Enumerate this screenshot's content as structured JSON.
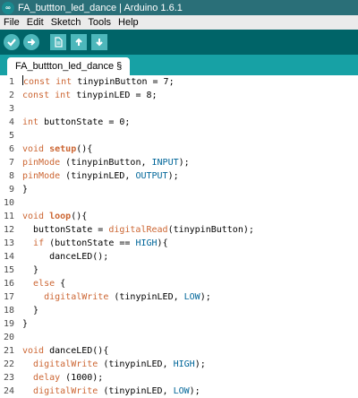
{
  "window": {
    "title": "FA_buttton_led_dance | Arduino 1.6.1"
  },
  "menu": [
    "File",
    "Edit",
    "Sketch",
    "Tools",
    "Help"
  ],
  "toolbar": [
    "verify-icon",
    "upload-icon",
    "new-icon",
    "open-icon",
    "save-icon"
  ],
  "tab": {
    "label": "FA_buttton_led_dance §"
  },
  "code_lines": [
    {
      "n": "1",
      "text": "const int tinypinButton = 7;"
    },
    {
      "n": "2",
      "text": "const int tinypinLED = 8;"
    },
    {
      "n": "3",
      "text": ""
    },
    {
      "n": "4",
      "text": "int buttonState = 0;"
    },
    {
      "n": "5",
      "text": ""
    },
    {
      "n": "6",
      "text": "void setup(){"
    },
    {
      "n": "7",
      "text": "pinMode (tinypinButton, INPUT);"
    },
    {
      "n": "8",
      "text": "pinMode (tinypinLED, OUTPUT);"
    },
    {
      "n": "9",
      "text": "}"
    },
    {
      "n": "10",
      "text": ""
    },
    {
      "n": "11",
      "text": "void loop(){"
    },
    {
      "n": "12",
      "text": "  buttonState = digitalRead(tinypinButton);"
    },
    {
      "n": "13",
      "text": "  if (buttonState == HIGH){"
    },
    {
      "n": "14",
      "text": "     danceLED();"
    },
    {
      "n": "15",
      "text": "  }"
    },
    {
      "n": "16",
      "text": "  else {"
    },
    {
      "n": "17",
      "text": "    digitalWrite (tinypinLED, LOW);"
    },
    {
      "n": "18",
      "text": "  }"
    },
    {
      "n": "19",
      "text": "}"
    },
    {
      "n": "20",
      "text": ""
    },
    {
      "n": "21",
      "text": "void danceLED(){"
    },
    {
      "n": "22",
      "text": "  digitalWrite (tinypinLED, HIGH);"
    },
    {
      "n": "23",
      "text": "  delay (1000);"
    },
    {
      "n": "24",
      "text": "  digitalWrite (tinypinLED, LOW);"
    }
  ]
}
